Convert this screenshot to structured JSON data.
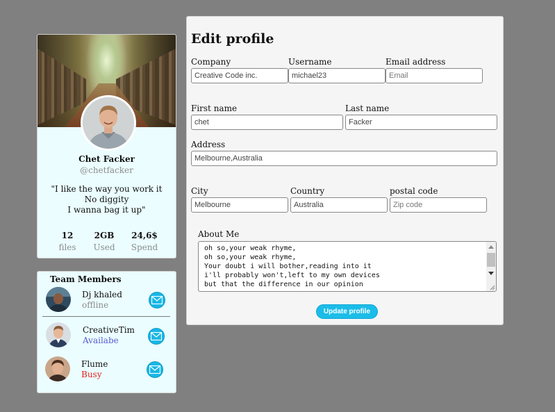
{
  "profile": {
    "name": "Chet Facker",
    "handle": "@chetfacker",
    "quote": [
      "\"I like the way you work it",
      "No diggity",
      "I wanna bag it up\""
    ],
    "stats": [
      {
        "value": "12",
        "label": "files"
      },
      {
        "value": "2GB",
        "label": "Used"
      },
      {
        "value": "24,6$",
        "label": "Spend"
      }
    ]
  },
  "team": {
    "title": "Team Members",
    "members": [
      {
        "name": "Dj khaled",
        "status": "offline",
        "status_color": "#8c8c8c"
      },
      {
        "name": "CreativeTim",
        "status": "Availabe",
        "status_color": "#5a5acd"
      },
      {
        "name": "Flume",
        "status": "Busy",
        "status_color": "#e0231d"
      }
    ]
  },
  "edit": {
    "title": "Edit profile",
    "fields": {
      "company": {
        "label": "Company",
        "value": "Creative Code inc.",
        "placeholder": ""
      },
      "username": {
        "label": "Username",
        "value": "michael23",
        "placeholder": ""
      },
      "email": {
        "label": "Email address",
        "value": "",
        "placeholder": "Email"
      },
      "first_name": {
        "label": "First name",
        "value": "chet",
        "placeholder": ""
      },
      "last_name": {
        "label": "Last name",
        "value": "Facker",
        "placeholder": ""
      },
      "address": {
        "label": "Address",
        "value": "Melbourne,Australia",
        "placeholder": ""
      },
      "city": {
        "label": "City",
        "value": "Melbourne",
        "placeholder": ""
      },
      "country": {
        "label": "Country",
        "value": "Australia",
        "placeholder": ""
      },
      "postal": {
        "label": "postal code",
        "value": "",
        "placeholder": "Zip code"
      }
    },
    "about": {
      "label": "About Me",
      "text": "oh so,your weak rhyme,\noh so,your weak rhyme,\nYour doubt i will bother,reading into it\ni'll probably won't,left to my own devices\nbut that the difference in our opinion"
    },
    "submit_label": "Update profile"
  },
  "colors": {
    "background": "#808080",
    "card_bg": "#ebfdff",
    "panel_bg": "#f5f5f5",
    "accent": "#1bbde8"
  }
}
